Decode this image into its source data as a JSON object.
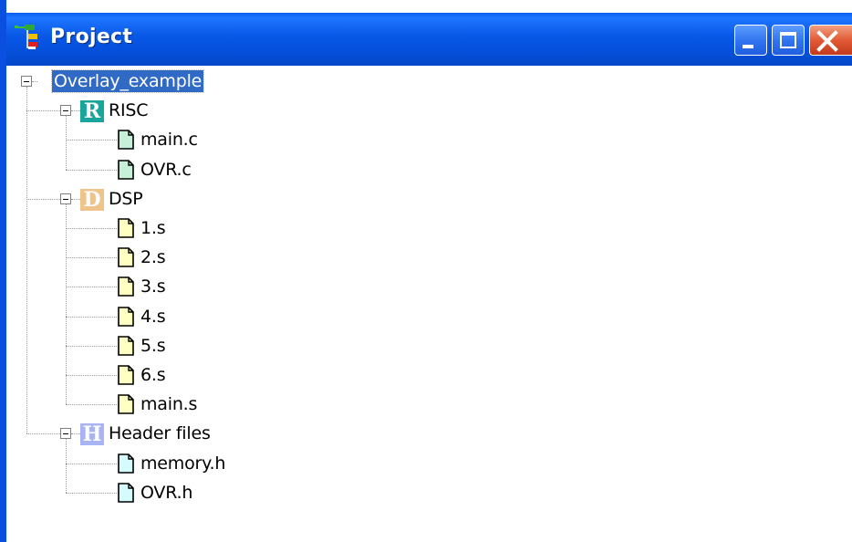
{
  "window": {
    "title": "Project",
    "icons": {
      "app": "project-tree-icon",
      "minimize": "minimize-icon",
      "maximize": "maximize-icon",
      "close": "close-icon"
    }
  },
  "tree": {
    "root": {
      "label": "Overlay_example",
      "expanded": true,
      "selected": true
    },
    "groups": [
      {
        "label": "RISC",
        "letter": "R",
        "color": "#1aa59c",
        "file_color": "#c6f0d8",
        "expanded": true,
        "files": [
          "main.c",
          "OVR.c"
        ]
      },
      {
        "label": "DSP",
        "letter": "D",
        "color": "#f0c38a",
        "file_color": "#ffffc4",
        "expanded": true,
        "files": [
          "1.s",
          "2.s",
          "3.s",
          "4.s",
          "5.s",
          "6.s",
          "main.s"
        ]
      },
      {
        "label": "Header files",
        "letter": "H",
        "color": "#a9b4f2",
        "file_color": "#d6fbff",
        "expanded": true,
        "files": [
          "memory.h",
          "OVR.h"
        ]
      }
    ]
  },
  "colors": {
    "titlebar": "#0550dc",
    "selection": "#316ac5",
    "close_button": "#e25a35"
  }
}
